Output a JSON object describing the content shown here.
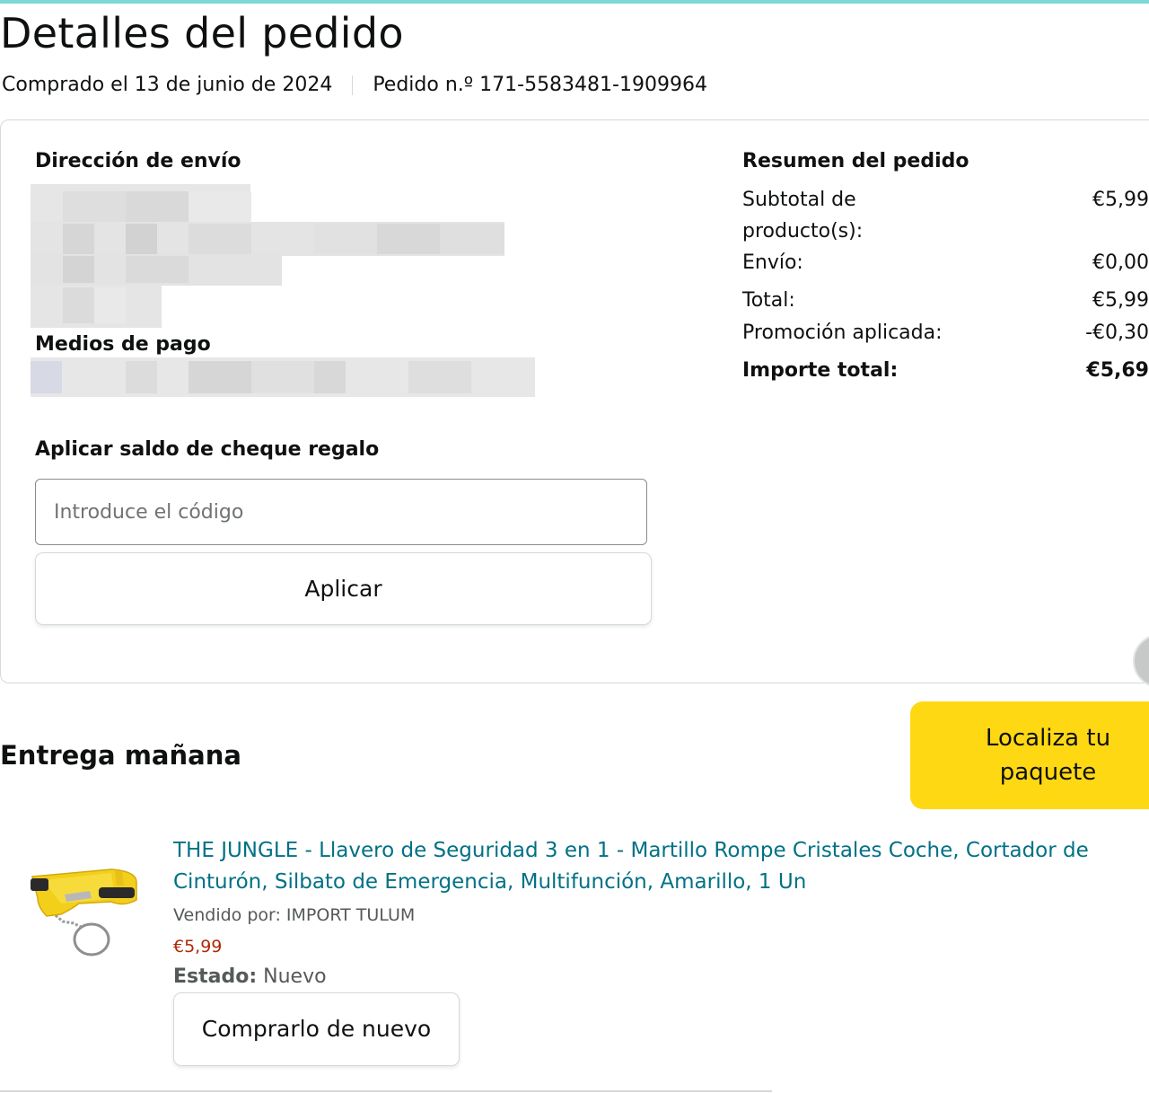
{
  "header": {
    "title": "Detalles del pedido",
    "purchase_date": "Comprado el 13 de junio de 2024",
    "order_number": "Pedido n.º 171-5583481-1909964"
  },
  "shipping": {
    "heading": "Dirección de envío"
  },
  "payment": {
    "heading": "Medios de pago"
  },
  "gift_card": {
    "heading": "Aplicar saldo de cheque regalo",
    "input_placeholder": "Introduce el código",
    "input_value": "",
    "apply_label": "Aplicar"
  },
  "summary": {
    "heading": "Resumen del pedido",
    "rows": [
      {
        "label": "Subtotal de producto(s):",
        "value": "€5,99"
      },
      {
        "label": "Envío:",
        "value": "€0,00"
      },
      {
        "label": "Total:",
        "value": "€5,99"
      },
      {
        "label": "Promoción aplicada:",
        "value": "-€0,30"
      },
      {
        "label": "Importe total:",
        "value": "€5,69"
      }
    ]
  },
  "delivery": {
    "heading": "Entrega mañana",
    "track_label_line1": "Localiza tu",
    "track_label_line2": "paquete"
  },
  "product": {
    "title": "THE JUNGLE - Llavero de Seguridad 3 en 1 - Martillo Rompe Cristales Coche, Cortador de Cinturón, Silbato de Emergencia, Multifunción, Amarillo, 1 Un",
    "seller": "Vendido por: IMPORT TULUM",
    "price": "€5,99",
    "status_label": "Estado:",
    "status_value": "Nuevo",
    "rebuy_label": "Comprarlo de nuevo"
  },
  "colors": {
    "accent_link": "#007185",
    "price": "#b12704",
    "track_button": "#ffd814",
    "top_bar": "#7fd8d6"
  }
}
